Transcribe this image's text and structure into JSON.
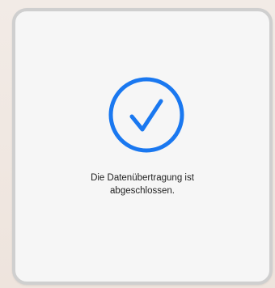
{
  "dialog": {
    "status_icon": "checkmark-circle-icon",
    "accent_color": "#1a78f0",
    "message_line1": "Die Datenübertragung ist",
    "message_line2": "abgeschlossen."
  }
}
